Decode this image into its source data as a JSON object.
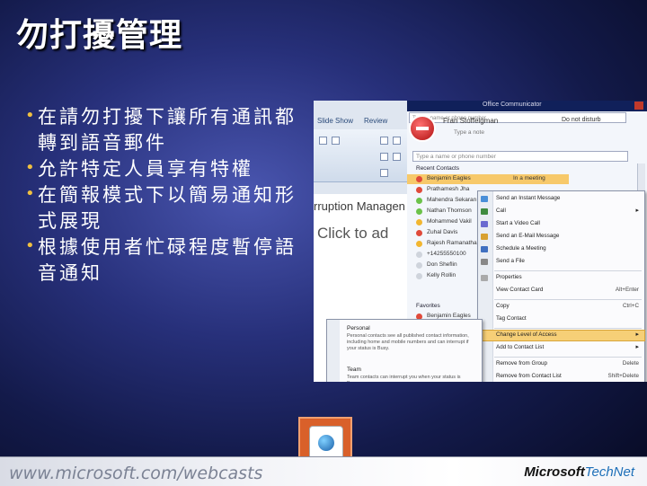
{
  "slide": {
    "title": "勿打擾管理",
    "bullets": [
      "在請勿打擾下讓所有通訊都轉到語音郵件",
      "允許特定人員享有特權",
      "在簡報模式下以簡易通知形式展現",
      "根據使用者忙碌程度暫停語音通知"
    ]
  },
  "ppt": {
    "tabs": [
      "Slide Show",
      "Review"
    ],
    "slide_header": "rruption Managen",
    "placeholder": "Click to ad"
  },
  "communicator": {
    "window_title": "Office Communicator",
    "search_placeholder": "Type a name or phone number",
    "user_name": "Fran Stoffelgman",
    "status": "Do not disturb",
    "note_placeholder": "Type a note",
    "phone_placeholder": "Type a name or phone number",
    "recent_header": "Recent Contacts",
    "favorites_header": "Favorites",
    "recent": [
      {
        "name": "Benjamin Eagles",
        "extra": "In a meeting",
        "status": "busy",
        "selected": true
      },
      {
        "name": "Prathamesh Jha",
        "extra": "",
        "status": "busy",
        "selected": false
      },
      {
        "name": "Mahendra Sekaran",
        "extra": "",
        "status": "available",
        "selected": false
      },
      {
        "name": "Nathan Thomson",
        "extra": "",
        "status": "available",
        "selected": false
      },
      {
        "name": "Mohammed Vakil",
        "extra": "",
        "status": "away",
        "selected": false
      },
      {
        "name": "Zuhal Davis",
        "extra": "",
        "status": "busy",
        "selected": false
      },
      {
        "name": "Rajesh Ramanathan",
        "extra": "",
        "status": "away",
        "selected": false
      },
      {
        "name": "+14255550100",
        "extra": "",
        "status": "offline",
        "selected": false
      },
      {
        "name": "Don Sheflin",
        "extra": "",
        "status": "offline",
        "selected": false
      },
      {
        "name": "Kelly Rollin",
        "extra": "",
        "status": "offline",
        "selected": false
      }
    ],
    "favorites": [
      {
        "name": "Benjamin Eagles",
        "status": "busy"
      }
    ],
    "status_colors": {
      "busy": "#e04a3a",
      "available": "#6cc24a",
      "away": "#f2b630",
      "offline": "#cfd4dc"
    }
  },
  "context_menu": {
    "items": [
      {
        "label": "Send an Instant Message",
        "shortcut": "",
        "arrow": false,
        "icon_color": "#4a8fd8"
      },
      {
        "label": "Call",
        "shortcut": "",
        "arrow": true,
        "icon_color": "#3f8b3f"
      },
      {
        "label": "Start a Video Call",
        "shortcut": "",
        "arrow": false,
        "icon_color": "#6a6ad0"
      },
      {
        "label": "Send an E-Mail Message",
        "shortcut": "",
        "arrow": false,
        "icon_color": "#d8a030"
      },
      {
        "label": "Schedule a Meeting",
        "shortcut": "",
        "arrow": false,
        "icon_color": "#4070c0"
      },
      {
        "label": "Send a File",
        "shortcut": "",
        "arrow": false,
        "icon_color": "#888888"
      },
      {
        "label": "Properties",
        "shortcut": "",
        "arrow": false,
        "icon_color": "#aaaaaa"
      },
      {
        "label": "View Contact Card",
        "shortcut": "Alt+Enter",
        "arrow": false,
        "icon_color": ""
      },
      {
        "label": "Copy",
        "shortcut": "Ctrl+C",
        "arrow": false,
        "icon_color": ""
      },
      {
        "label": "Tag Contact",
        "shortcut": "",
        "arrow": false,
        "icon_color": ""
      },
      {
        "label": "Change Level of Access",
        "shortcut": "",
        "arrow": true,
        "icon_color": "",
        "highlighted": true
      },
      {
        "label": "Add to Contact List",
        "shortcut": "",
        "arrow": true,
        "icon_color": ""
      },
      {
        "label": "Remove from Group",
        "shortcut": "Delete",
        "arrow": false,
        "icon_color": ""
      },
      {
        "label": "Remove from Contact List",
        "shortcut": "Shift+Delete",
        "arrow": false,
        "icon_color": ""
      }
    ]
  },
  "submenu": {
    "personal_title": "Personal",
    "personal_desc": "Personal contacts see all published contact information, including home and mobile numbers and can interrupt if your status is Busy.",
    "team_title": "Team",
    "team_desc": "Team contacts can interrupt you when your status is Busy."
  },
  "footer": {
    "url": "www.microsoft.com/webcasts",
    "brand": "Microsoft",
    "brand_suffix": "TechNet"
  }
}
